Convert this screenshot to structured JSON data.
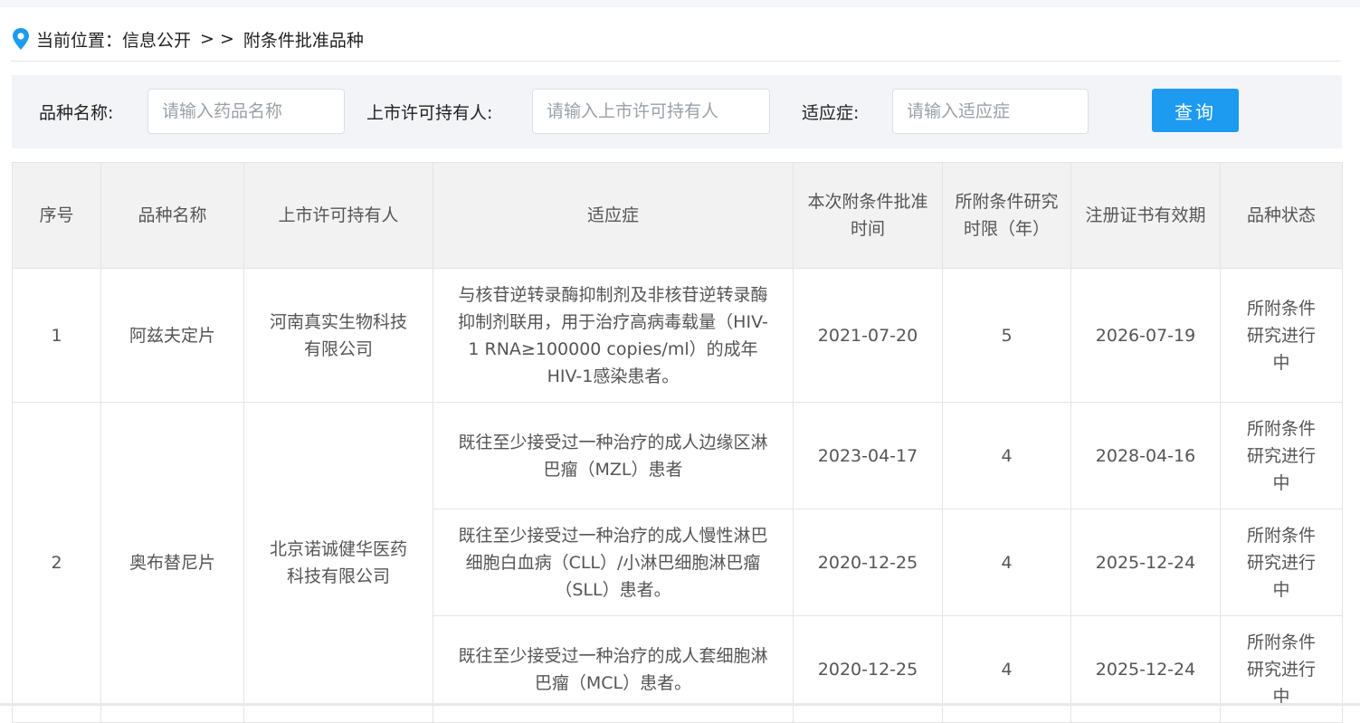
{
  "breadcrumb": {
    "label": "当前位置：",
    "items": [
      "信息公开",
      "附条件批准品种"
    ],
    "separator": "> >"
  },
  "search": {
    "name_label": "品种名称:",
    "name_placeholder": "请输入药品名称",
    "holder_label": "上市许可持有人:",
    "holder_placeholder": "请输入上市许可持有人",
    "indication_label": "适应症:",
    "indication_placeholder": "请输入适应症",
    "query_button": "查询"
  },
  "table": {
    "headers": [
      "序号",
      "品种名称",
      "上市许可持有人",
      "适应症",
      "本次附条件批准时间",
      "所附条件研究时限（年）",
      "注册证书有效期",
      "品种状态"
    ],
    "groups": [
      {
        "no": "1",
        "name": "阿兹夫定片",
        "holder": "河南真实生物科技有限公司",
        "rows": [
          {
            "indication": "与核苷逆转录酶抑制剂及非核苷逆转录酶抑制剂联用，用于治疗高病毒载量（HIV-1 RNA≥100000 copies/ml）的成年HIV-1感染患者。",
            "approval": "2021-07-20",
            "limit": "5",
            "validity": "2026-07-19",
            "status": "所附条件研究进行中"
          }
        ]
      },
      {
        "no": "2",
        "name": "奥布替尼片",
        "holder": "北京诺诚健华医药科技有限公司",
        "rows": [
          {
            "indication": "既往至少接受过一种治疗的成人边缘区淋巴瘤（MZL）患者",
            "approval": "2023-04-17",
            "limit": "4",
            "validity": "2028-04-16",
            "status": "所附条件研究进行中"
          },
          {
            "indication": "既往至少接受过一种治疗的成人慢性淋巴细胞白血病（CLL）/小淋巴细胞淋巴瘤（SLL）患者。",
            "approval": "2020-12-25",
            "limit": "4",
            "validity": "2025-12-24",
            "status": "所附条件研究进行中"
          },
          {
            "indication": "既往至少接受过一种治疗的成人套细胞淋巴瘤（MCL）患者。",
            "approval": "2020-12-25",
            "limit": "4",
            "validity": "2025-12-24",
            "status": "所附条件研究进行中"
          }
        ]
      }
    ]
  }
}
